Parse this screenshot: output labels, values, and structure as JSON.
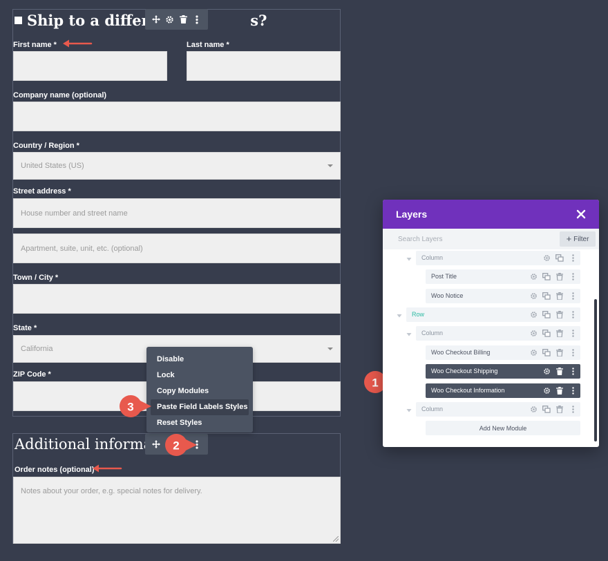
{
  "shipping_form": {
    "heading": "Ship to a differen",
    "heading_tail": "s?",
    "first_name_label": "First name *",
    "last_name_label": "Last name *",
    "company_label": "Company name (optional)",
    "country_label": "Country / Region *",
    "country_value": "United States (US)",
    "street_label": "Street address *",
    "street_placeholder_1": "House number and street name",
    "street_placeholder_2": "Apartment, suite, unit, etc. (optional)",
    "town_label": "Town / City *",
    "state_label": "State *",
    "state_value": "California",
    "zip_label": "ZIP Code *"
  },
  "info_form": {
    "heading": "Additional informa",
    "order_notes_label": "Order notes (optional)",
    "order_notes_placeholder": "Notes about your order, e.g. special notes for delivery."
  },
  "context_menu": {
    "items": [
      "Disable",
      "Lock",
      "Copy Modules",
      "Paste Field Labels Styles",
      "Reset Styles"
    ],
    "active_index": 3
  },
  "callouts": [
    "1",
    "2",
    "3"
  ],
  "layers_panel": {
    "title": "Layers",
    "search_placeholder": "Search Layers",
    "filter_label": "Filter",
    "rows": [
      {
        "name": "Column",
        "kind": "column"
      },
      {
        "name": "Post Title",
        "kind": "module"
      },
      {
        "name": "Woo Notice",
        "kind": "module"
      },
      {
        "name": "Row",
        "kind": "row"
      },
      {
        "name": "Column",
        "kind": "column"
      },
      {
        "name": "Woo Checkout Billing",
        "kind": "module"
      },
      {
        "name": "Woo Checkout Shipping",
        "kind": "module-selected"
      },
      {
        "name": "Woo Checkout Information",
        "kind": "module-selected"
      },
      {
        "name": "Column",
        "kind": "column"
      }
    ],
    "add_module_label": "Add New Module"
  },
  "colors": {
    "background": "#373d4d",
    "layers_header": "#7031bc",
    "callout": "#e8594d",
    "row_accent": "#2bbaa2"
  }
}
